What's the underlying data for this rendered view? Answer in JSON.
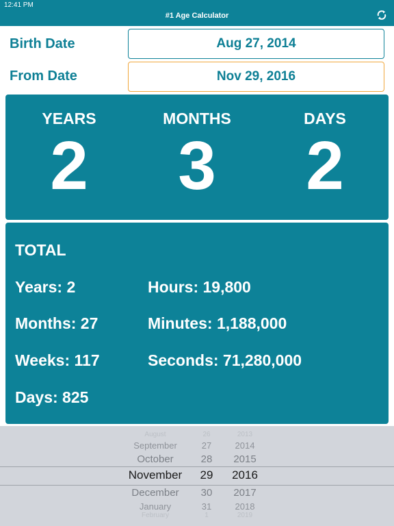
{
  "status_bar": {
    "time": "12:41 PM"
  },
  "header": {
    "title": "#1 Age Calculator",
    "refresh_icon": "refresh-icon"
  },
  "inputs": {
    "birth": {
      "label": "Birth Date",
      "value": "Aug 27, 2014"
    },
    "from": {
      "label": "From Date",
      "value": "Nov 29, 2016"
    }
  },
  "age": {
    "years": {
      "label": "YEARS",
      "value": "2"
    },
    "months": {
      "label": "MONTHS",
      "value": "3"
    },
    "days": {
      "label": "DAYS",
      "value": "2"
    }
  },
  "total": {
    "title": "TOTAL",
    "years": "Years: 2",
    "months": "Months: 27",
    "weeks": "Weeks: 117",
    "days": "Days: 825",
    "hours": "Hours: 19,800",
    "minutes": "Minutes: 1,188,000",
    "seconds": "Seconds: 71,280,000"
  },
  "picker": {
    "months": [
      "August",
      "September",
      "October",
      "November",
      "December",
      "January",
      "February"
    ],
    "days": [
      "26",
      "27",
      "28",
      "29",
      "30",
      "31",
      "1"
    ],
    "years": [
      "2013",
      "2014",
      "2015",
      "2016",
      "2017",
      "2018",
      "2019"
    ],
    "selected_index": 3
  },
  "colors": {
    "primary": "#0d8298",
    "accent_border": "#f0a63b",
    "picker_bg": "#d2d5db"
  }
}
